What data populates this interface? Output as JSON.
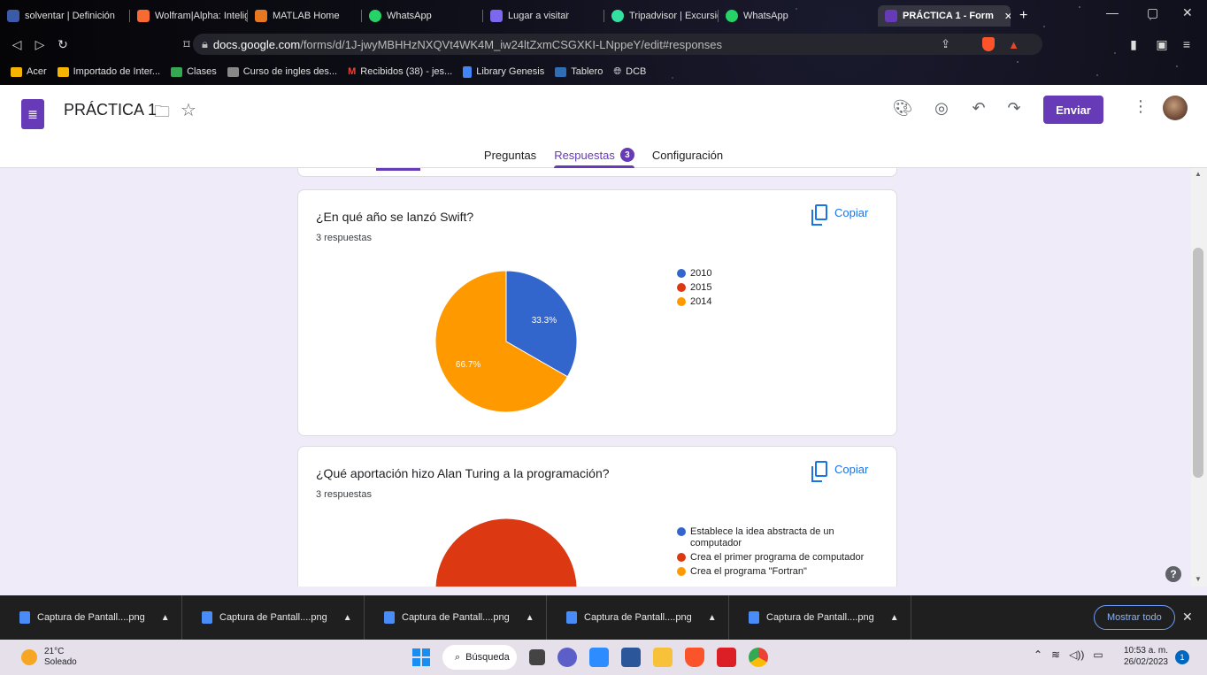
{
  "browser": {
    "tabs": [
      {
        "label": "solventar | Definición",
        "color": "#3b5ba9"
      },
      {
        "label": "Wolfram|Alpha: Intelig",
        "color": "#f96932"
      },
      {
        "label": "MATLAB Home",
        "color": "#e87722"
      },
      {
        "label": "WhatsApp",
        "color": "#25d366"
      },
      {
        "label": "Lugar a visitar",
        "color": "#7b68ee"
      },
      {
        "label": "Tripadvisor | Excursión",
        "color": "#34e0a1"
      },
      {
        "label": "WhatsApp",
        "color": "#25d366"
      },
      {
        "label": "PRÁCTICA 1 - Form",
        "color": "#673ab7",
        "active": true
      }
    ],
    "new_tab": "+",
    "url_host": "docs.google.com",
    "url_path": "/forms/d/1J-jwyMBHHzNXQVt4WK4M_iw24ltZxmCSGXKI-LNppeY/edit#responses",
    "bookmarks": [
      {
        "label": "Acer",
        "color": "#f4b400"
      },
      {
        "label": "Importado de Inter...",
        "color": "#f4b400"
      },
      {
        "label": "Clases",
        "color": "#34a853"
      },
      {
        "label": "Curso de ingles des...",
        "color": "#888888"
      },
      {
        "label": "Recibidos (38) - jes...",
        "color": "#ea4335"
      },
      {
        "label": "Library Genesis",
        "color": "#4285f4"
      },
      {
        "label": "Tablero",
        "color": "#2f6db5"
      },
      {
        "label": "DCB",
        "color": "#666666"
      }
    ]
  },
  "form": {
    "title": "PRÁCTICA 1",
    "send_label": "Enviar",
    "tabs": {
      "questions": "Preguntas",
      "responses": "Respuestas",
      "responses_count": "3",
      "settings": "Configuración"
    }
  },
  "cards": [
    {
      "question": "¿En qué año se lanzó Swift?",
      "count": "3 respuestas",
      "copy_label": "Copiar"
    },
    {
      "question": "¿Qué aportación hizo Alan Turing a la programación?",
      "count": "3 respuestas",
      "copy_label": "Copiar"
    }
  ],
  "chart_data": [
    {
      "type": "pie",
      "title": "¿En qué año se lanzó Swift?",
      "categories": [
        "2010",
        "2015",
        "2014"
      ],
      "values": [
        33.3,
        0,
        66.7
      ],
      "labels": [
        "33.3%",
        "",
        "66.7%"
      ],
      "colors": [
        "#3366cc",
        "#dc3912",
        "#ff9900"
      ],
      "legend": "right"
    },
    {
      "type": "pie",
      "title": "¿Qué aportación hizo Alan Turing a la programación?",
      "categories": [
        "Establece la idea abstracta de un computador",
        "Crea el primer programa de computador",
        "Crea el programa \"Fortran\""
      ],
      "values": [
        0,
        100,
        0
      ],
      "colors": [
        "#3366cc",
        "#dc3912",
        "#ff9900"
      ],
      "legend": "right"
    }
  ],
  "downloads": {
    "items": [
      "Captura de Pantall....png",
      "Captura de Pantall....png",
      "Captura de Pantall....png",
      "Captura de Pantall....png",
      "Captura de Pantall....png"
    ],
    "show_all": "Mostrar todo"
  },
  "taskbar": {
    "temp": "21°C",
    "weather": "Soleado",
    "search": "Búsqueda",
    "time": "10:53 a. m.",
    "date": "26/02/2023",
    "notifications": "1"
  }
}
